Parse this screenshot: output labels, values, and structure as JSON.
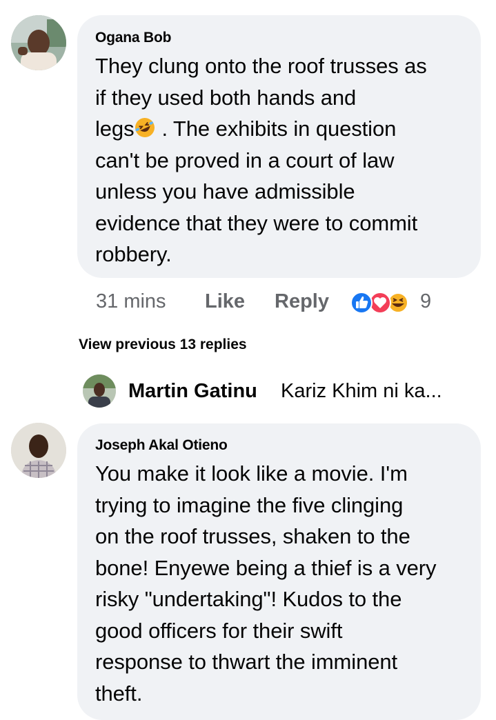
{
  "comments": [
    {
      "author": "Ogana Bob",
      "lines": [
        "They clung onto the roof trusses as",
        "if they used both hands and",
        "legs",
        ". The exhibits in question",
        "can't be proved in a court of law",
        "unless you have admissible",
        "evidence that they were to commit",
        "robbery."
      ],
      "time": "31 mins",
      "like_label": "Like",
      "reply_label": "Reply",
      "reaction_count": "9",
      "reaction_icons": [
        "like-reaction-icon",
        "love-reaction-icon",
        "haha-reaction-icon"
      ]
    },
    {
      "author": "Joseph Akal Otieno",
      "lines": [
        "You make it look like a movie. I'm",
        "trying to imagine the five clinging",
        "on the roof trusses, shaken to the",
        "bone! Enyewe being a thief is a very",
        "risky \"undertaking\"! Kudos to the",
        "good officers for their swift",
        "response to thwart the imminent",
        "theft."
      ]
    }
  ],
  "view_previous": "View previous 13 replies",
  "reply_preview": {
    "name": "Martin Gatinu",
    "text": "Kariz Khim ni ka..."
  },
  "colors": {
    "bubble": "#f0f2f5",
    "meta": "#65676b",
    "like_blue": "#1877f2",
    "love_red": "#f33e58",
    "haha_yellow": "#f7b125"
  }
}
